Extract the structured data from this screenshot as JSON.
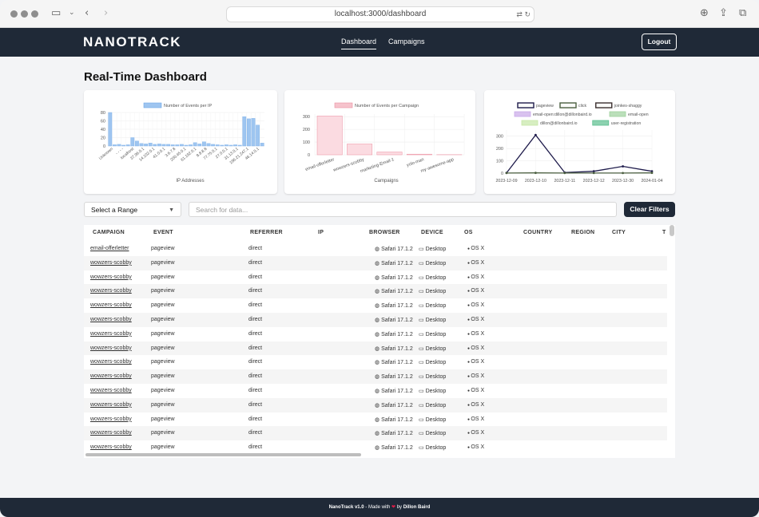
{
  "browser": {
    "url": "localhost:3000/dashboard"
  },
  "nav": {
    "logo": "NANOTRACK",
    "links": [
      "Dashboard",
      "Campaigns"
    ],
    "logout": "Logout"
  },
  "page": {
    "title": "Real-Time Dashboard"
  },
  "filters": {
    "range_label": "Select a Range",
    "search_placeholder": "Search for data...",
    "clear_label": "Clear Filters"
  },
  "table": {
    "columns": [
      "CAMPAIGN",
      "EVENT",
      "REFERRER",
      "IP",
      "BROWSER",
      "DEVICE",
      "OS",
      "COUNTRY",
      "REGION",
      "CITY",
      "T"
    ],
    "rows": [
      [
        "email-offerletter",
        "pageview",
        "direct",
        "",
        "Safari 17.1.2",
        "Desktop",
        "OS X"
      ],
      [
        "wowzers-scobby",
        "pageview",
        "direct",
        "",
        "Safari 17.1.2",
        "Desktop",
        "OS X"
      ],
      [
        "wowzers-scobby",
        "pageview",
        "direct",
        "",
        "Safari 17.1.2",
        "Desktop",
        "OS X"
      ],
      [
        "wowzers-scobby",
        "pageview",
        "direct",
        "",
        "Safari 17.1.2",
        "Desktop",
        "OS X"
      ],
      [
        "wowzers-scobby",
        "pageview",
        "direct",
        "",
        "Safari 17.1.2",
        "Desktop",
        "OS X"
      ],
      [
        "wowzers-scobby",
        "pageview",
        "direct",
        "",
        "Safari 17.1.2",
        "Desktop",
        "OS X"
      ],
      [
        "wowzers-scobby",
        "pageview",
        "direct",
        "",
        "Safari 17.1.2",
        "Desktop",
        "OS X"
      ],
      [
        "wowzers-scobby",
        "pageview",
        "direct",
        "",
        "Safari 17.1.2",
        "Desktop",
        "OS X"
      ],
      [
        "wowzers-scobby",
        "pageview",
        "direct",
        "",
        "Safari 17.1.2",
        "Desktop",
        "OS X"
      ],
      [
        "wowzers-scobby",
        "pageview",
        "direct",
        "",
        "Safari 17.1.2",
        "Desktop",
        "OS X"
      ],
      [
        "wowzers-scobby",
        "pageview",
        "direct",
        "",
        "Safari 17.1.2",
        "Desktop",
        "OS X"
      ],
      [
        "wowzers-scobby",
        "pageview",
        "direct",
        "",
        "Safari 17.1.2",
        "Desktop",
        "OS X"
      ],
      [
        "wowzers-scobby",
        "pageview",
        "direct",
        "",
        "Safari 17.1.2",
        "Desktop",
        "OS X"
      ],
      [
        "wowzers-scobby",
        "pageview",
        "direct",
        "",
        "Safari 17.1.2",
        "Desktop",
        "OS X"
      ],
      [
        "wowzers-scobby",
        "pageview",
        "direct",
        "",
        "Safari 17.1.2",
        "Desktop",
        "OS X"
      ]
    ]
  },
  "footer": {
    "prefix": "NanoTrack v1.0",
    "middle": " - Made with ",
    "by": " by ",
    "author": "Dillon Baird"
  },
  "chart_data": [
    {
      "type": "bar",
      "legend": [
        "Number of Events per IP"
      ],
      "xlabel": "IP Addresses",
      "ylim": [
        0,
        80
      ],
      "yticks": [
        0,
        20,
        40,
        60,
        80
      ],
      "x_tick_labels": [
        "Unknown",
        "- - - -",
        "localhost",
        "37.96.0.1",
        "14.102.0.1",
        "41.0.0.1",
        "3.6.7.8",
        "200.45.0.1",
        "61.192.0.1",
        "8.8.8.8",
        "77.75.0.1",
        "27.0.0.1",
        "31.13.0.1",
        "196.21.247.1",
        "46.14.0.1"
      ],
      "values": [
        80,
        3,
        4,
        2,
        3,
        20,
        12,
        6,
        5,
        7,
        4,
        5,
        4,
        4,
        3,
        3,
        4,
        2,
        3,
        8,
        5,
        10,
        6,
        4,
        3,
        2,
        3,
        2,
        3,
        2,
        70,
        65,
        66,
        50,
        7
      ],
      "color": "#9ec5f0"
    },
    {
      "type": "bar",
      "legend": [
        "Number of Events per Campaign"
      ],
      "xlabel": "Campaigns",
      "ylim": [
        0,
        320
      ],
      "yticks": [
        0,
        100,
        200,
        300
      ],
      "categories": [
        "email-offerletter",
        "wowzers-scobby",
        "marketing-Email-1",
        "yolo-man",
        "my-awesome-app"
      ],
      "values": [
        305,
        85,
        22,
        5,
        1
      ],
      "color": "#f6c3cc"
    },
    {
      "type": "line",
      "legend": [
        "pageview",
        "click",
        "joinkes-shaggy",
        "email-open:dillon@dillonbaird.io",
        "email-open",
        "dillon@dillonbaird.io",
        "user-registration"
      ],
      "legend_colors": [
        "#1e1b4b",
        "#4b5f40",
        "#3b2f2f",
        "#c9a8e8",
        "#9ed19c",
        "#c6e7a6",
        "#5bbf8f"
      ],
      "x": [
        "2023-12-09",
        "2023-12-10",
        "2023-12-11",
        "2023-12-12",
        "2023-12-30",
        "2024-01-04"
      ],
      "ylim": [
        0,
        350
      ],
      "yticks": [
        0,
        100,
        200,
        300
      ],
      "series": [
        {
          "name": "pageview",
          "values": [
            2,
            310,
            5,
            15,
            55,
            15
          ]
        },
        {
          "name": "click",
          "values": [
            1,
            2,
            1,
            1,
            1,
            2
          ]
        }
      ]
    }
  ]
}
